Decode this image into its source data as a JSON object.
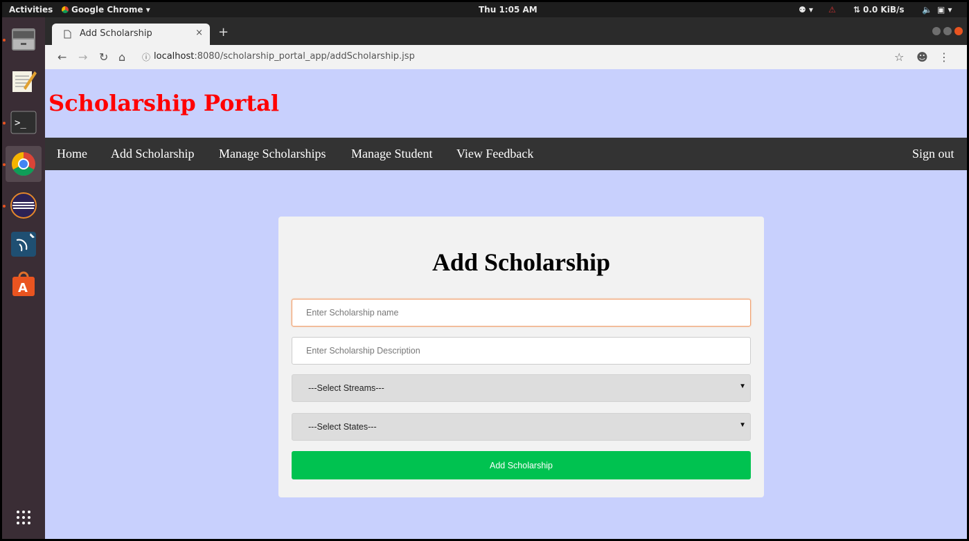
{
  "topbar": {
    "activities": "Activities",
    "app": "Google Chrome ▾",
    "clock": "Thu 1:05 AM",
    "net": "0.0 KiB/s"
  },
  "browser": {
    "tab_title": "Add Scholarship",
    "tab_close": "×",
    "new_tab": "+",
    "url_host": "localhost",
    "url_path": ":8080/scholarship_portal_app/addScholarship.jsp"
  },
  "site": {
    "title": "Scholarship Portal",
    "nav": [
      "Home",
      "Add Scholarship",
      "Manage Scholarships",
      "Manage Student",
      "View Feedback"
    ],
    "signout": "Sign out"
  },
  "form": {
    "title": "Add Scholarship",
    "name_placeholder": "Enter Scholarship name",
    "desc_placeholder": "Enter Scholarship Description",
    "streams_selected": "---Select Streams---",
    "states_selected": "---Select States---",
    "submit_label": "Add Scholarship"
  },
  "colors": {
    "page_bg": "#c8d0fd",
    "title_red": "#ff0000",
    "navbar": "#333333",
    "submit_green": "#00c250"
  }
}
